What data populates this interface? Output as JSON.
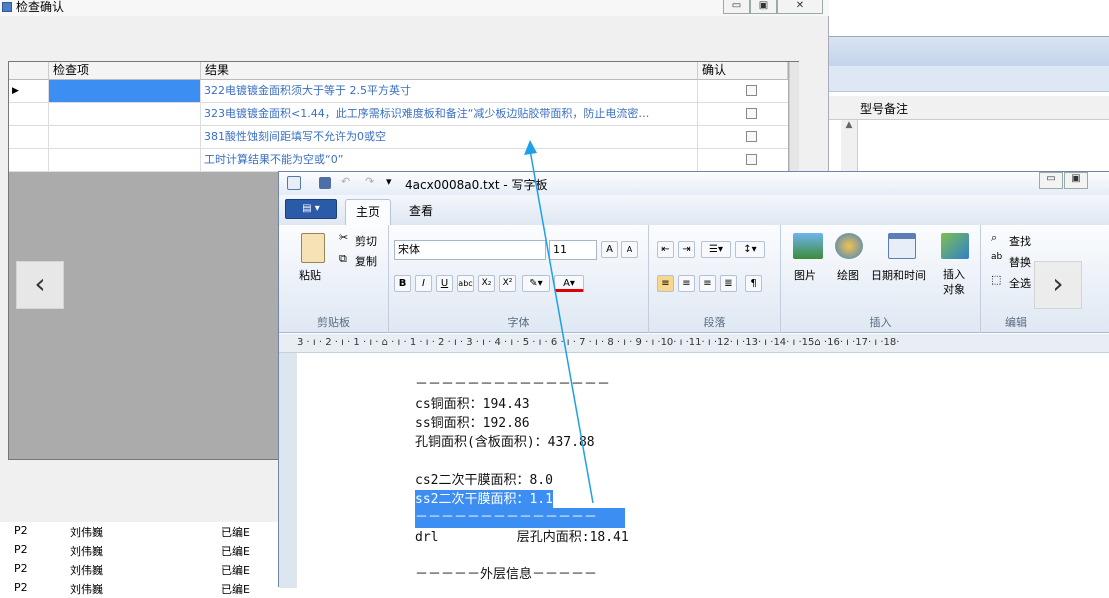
{
  "back_window": {
    "title": "检查确认",
    "controls": [
      "▭",
      "▣",
      "✕"
    ],
    "grid": {
      "headers": [
        "检查项",
        "结果",
        "确认"
      ],
      "rows": [
        {
          "item": "",
          "result": "322电镀镀金面积须大于等于 2.5平方英寸"
        },
        {
          "item": "",
          "result": "323电镀镀金面积<1.44，此工序需标识难度板和备注“减少板边贴胶带面积，防止电流密…"
        },
        {
          "item": "",
          "result": "381酸性蚀刻间距填写不允许为0或空"
        },
        {
          "item": "",
          "result": "工时计算结果不能为空或“0”"
        }
      ]
    }
  },
  "right_window": {
    "column_header": "型号备注"
  },
  "bottom_list": [
    {
      "code": "P2",
      "name": "刘伟巍",
      "status": "已编E"
    },
    {
      "code": "P2",
      "name": "刘伟巍",
      "status": "已编E"
    },
    {
      "code": "P2",
      "name": "刘伟巍",
      "status": "已编E"
    },
    {
      "code": "P2",
      "name": "刘伟巍",
      "status": "已编E"
    }
  ],
  "wordpad": {
    "title": "4acx0008a0.txt - 写字板",
    "tabs": [
      "主页",
      "查看"
    ],
    "clipboard": {
      "paste": "粘贴",
      "cut": "剪切",
      "copy": "复制",
      "group": "剪贴板"
    },
    "font": {
      "name": "宋体",
      "size": "11",
      "group": "字体",
      "bold": "B",
      "italic": "I",
      "underline": "U",
      "strike": "abc",
      "sub": "X₂",
      "sup": "X²"
    },
    "paragraph": {
      "group": "段落"
    },
    "insert": {
      "picture": "图片",
      "paint": "绘图",
      "datetime": "日期和时间",
      "object": "插入对象",
      "group": "插入"
    },
    "editing": {
      "find": "查找",
      "replace": "替换",
      "select_all": "全选",
      "group": "编辑"
    },
    "ruler": "3 · ı · 2 · ı · 1 · ı · ⌂ · ı · 1 · ı · 2 · ı · 3 · ı · 4 · ı · 5 · ı · 6 · ı · 7 · ı · 8 · ı · 9 · ı ·10· ı ·11· ı ·12· ı ·13· ı ·14· ı ·15⌂ ·16· ı ·17· ı ·18·",
    "doc_lines": [
      "－－－－－－－－－－－－－－－",
      "cs铜面积：194.43",
      "ss铜面积：192.86",
      "孔铜面积(含板面积)：437.88",
      "",
      "cs2二次干膜面积：8.0",
      "ss2二次干膜面积：1.1",
      "－－－－－－－－－－－－－－",
      "drl          层孔内面积:18.41",
      "",
      "－－－－－外层信息－－－－－"
    ]
  },
  "nav": {
    "prev": "‹",
    "next": "›"
  },
  "colors": {
    "arrow": "#1ea0e8",
    "selection": "#3d8ef3",
    "link_text": "#3a6fc2"
  }
}
